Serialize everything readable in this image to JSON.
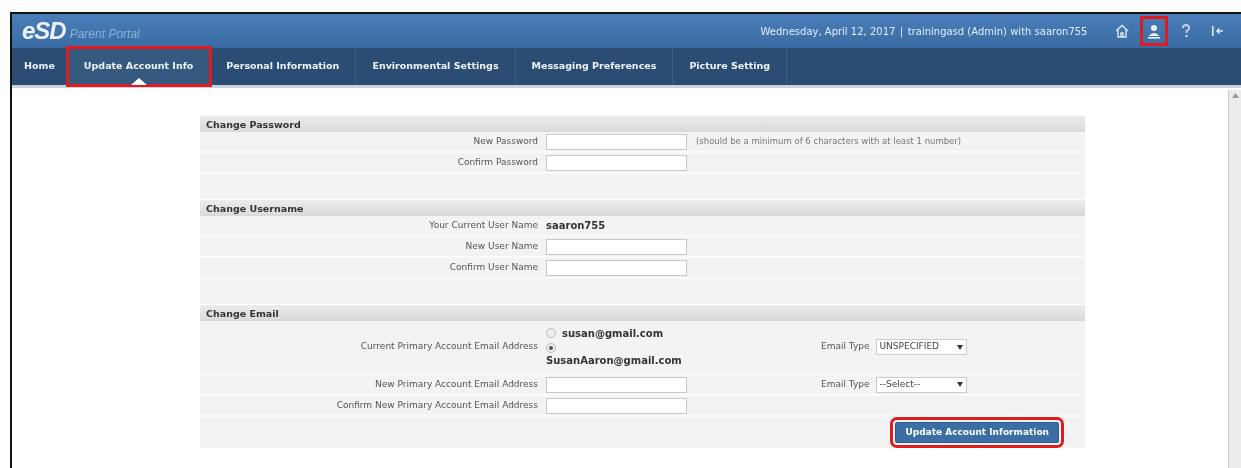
{
  "header": {
    "logo": "eSD",
    "subtitle": "Parent Portal",
    "date": "Wednesday, April 12, 2017",
    "separator": "|",
    "user": "trainingasd (Admin) with saaron755",
    "icons": [
      {
        "kind": "home",
        "highlighted": false
      },
      {
        "kind": "user",
        "highlighted": true
      },
      {
        "kind": "help",
        "highlighted": false
      },
      {
        "kind": "logout",
        "highlighted": false
      }
    ]
  },
  "tabs": [
    {
      "label": "Home",
      "selected": false,
      "highlighted": false
    },
    {
      "label": "Update Account Info",
      "selected": true,
      "highlighted": true
    },
    {
      "label": "Personal Information",
      "selected": false,
      "highlighted": false
    },
    {
      "label": "Environmental Settings",
      "selected": false,
      "highlighted": false
    },
    {
      "label": "Messaging Preferences",
      "selected": false,
      "highlighted": false
    },
    {
      "label": "Picture Setting",
      "selected": false,
      "highlighted": false
    }
  ],
  "sections": [
    {
      "title": "Change Password",
      "rows": [
        {
          "kind": "input",
          "label": "New Password",
          "hint": "(should be a minimum of 6 characters with at least 1 number)"
        },
        {
          "kind": "input",
          "label": "Confirm Password"
        }
      ]
    },
    {
      "title": "Change Username",
      "rows": [
        {
          "kind": "text",
          "label": "Your Current User Name",
          "value": "saaron755"
        },
        {
          "kind": "input",
          "label": "New User Name"
        },
        {
          "kind": "input",
          "label": "Confirm User Name"
        }
      ]
    },
    {
      "title": "Change Email",
      "rows": [
        {
          "kind": "radio",
          "label": "Current Primary Account Email Address",
          "options": [
            {
              "label": "susan@gmail.com",
              "selected": false
            },
            {
              "label": "SusanAaron@gmail.com",
              "selected": true
            }
          ],
          "email_type": {
            "label": "Email Type",
            "value": "UNSPECIFIED"
          }
        },
        {
          "kind": "input",
          "label": "New Primary Account Email Address",
          "email_type": {
            "label": "Email Type",
            "value": "--Select--"
          }
        },
        {
          "kind": "input",
          "label": "Confirm New Primary Account Email Address"
        }
      ]
    }
  ],
  "submit": {
    "label": "Update Account Information",
    "highlighted": true
  }
}
